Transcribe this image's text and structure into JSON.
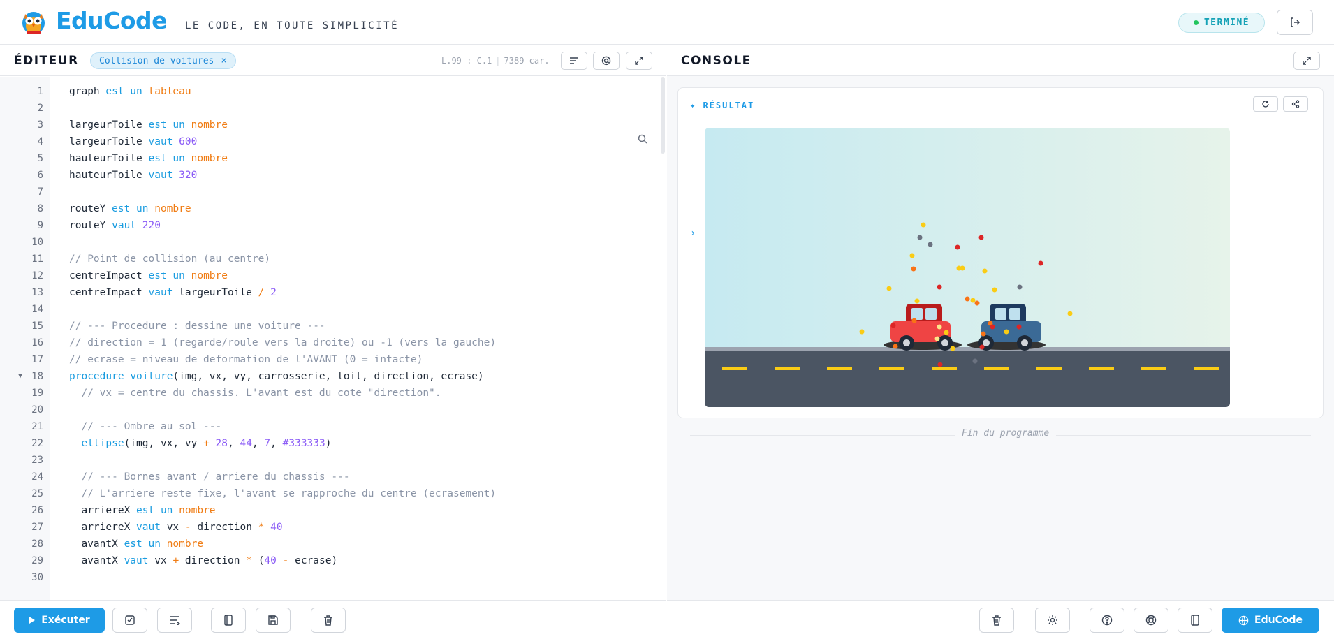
{
  "header": {
    "brand": "EduCode",
    "tagline": "LE CODE, EN TOUTE SIMPLICITÉ",
    "status": "TERMINÉ",
    "logout_icon": "logout-icon"
  },
  "editor": {
    "title": "ÉDITEUR",
    "file_tab": "Collision de voitures",
    "file_tab_close": "×",
    "cursor_line": "L.99",
    "cursor_col": "C.1",
    "char_count": "7389 car.",
    "buttons": [
      "format-icon",
      "at-icon",
      "expand-icon"
    ]
  },
  "code": {
    "line_numbers": [
      "1",
      "2",
      "3",
      "4",
      "5",
      "6",
      "7",
      "8",
      "9",
      "10",
      "11",
      "12",
      "13",
      "14",
      "15",
      "16",
      "17",
      "18",
      "19",
      "20",
      "21",
      "22",
      "23",
      "24",
      "25",
      "26",
      "27",
      "28",
      "29",
      "30"
    ],
    "lines": [
      [
        {
          "t": "graph ",
          "c": ""
        },
        {
          "t": "est un ",
          "c": "k"
        },
        {
          "t": "tableau",
          "c": "t"
        }
      ],
      [],
      [
        {
          "t": "largeurToile ",
          "c": ""
        },
        {
          "t": "est un ",
          "c": "k"
        },
        {
          "t": "nombre",
          "c": "t"
        }
      ],
      [
        {
          "t": "largeurToile ",
          "c": ""
        },
        {
          "t": "vaut ",
          "c": "k"
        },
        {
          "t": "600",
          "c": "n"
        }
      ],
      [
        {
          "t": "hauteurToile ",
          "c": ""
        },
        {
          "t": "est un ",
          "c": "k"
        },
        {
          "t": "nombre",
          "c": "t"
        }
      ],
      [
        {
          "t": "hauteurToile ",
          "c": ""
        },
        {
          "t": "vaut ",
          "c": "k"
        },
        {
          "t": "320",
          "c": "n"
        }
      ],
      [],
      [
        {
          "t": "routeY ",
          "c": ""
        },
        {
          "t": "est un ",
          "c": "k"
        },
        {
          "t": "nombre",
          "c": "t"
        }
      ],
      [
        {
          "t": "routeY ",
          "c": ""
        },
        {
          "t": "vaut ",
          "c": "k"
        },
        {
          "t": "220",
          "c": "n"
        }
      ],
      [],
      [
        {
          "t": "// Point de collision (au centre)",
          "c": "c"
        }
      ],
      [
        {
          "t": "centreImpact ",
          "c": ""
        },
        {
          "t": "est un ",
          "c": "k"
        },
        {
          "t": "nombre",
          "c": "t"
        }
      ],
      [
        {
          "t": "centreImpact ",
          "c": ""
        },
        {
          "t": "vaut ",
          "c": "k"
        },
        {
          "t": "largeurToile ",
          "c": ""
        },
        {
          "t": "/ ",
          "c": "op"
        },
        {
          "t": "2",
          "c": "n"
        }
      ],
      [],
      [
        {
          "t": "// --- Procedure : dessine une voiture ---",
          "c": "c"
        }
      ],
      [
        {
          "t": "// direction = 1 (regarde/roule vers la droite) ou -1 (vers la gauche)",
          "c": "c"
        }
      ],
      [
        {
          "t": "// ecrase = niveau de deformation de l'AVANT (0 = intacte)",
          "c": "c"
        }
      ],
      [
        {
          "t": "procedure ",
          "c": "k"
        },
        {
          "t": "voiture",
          "c": "f"
        },
        {
          "t": "(img, vx, vy, carrosserie, toit, direction, ecrase)",
          "c": ""
        }
      ],
      [
        {
          "t": "  // vx = centre du chassis. L'avant est du cote \"direction\".",
          "c": "c"
        }
      ],
      [],
      [
        {
          "t": "  // --- Ombre au sol ---",
          "c": "c"
        }
      ],
      [
        {
          "t": "  ",
          "c": ""
        },
        {
          "t": "ellipse",
          "c": "f"
        },
        {
          "t": "(img, vx, vy ",
          "c": ""
        },
        {
          "t": "+ ",
          "c": "op"
        },
        {
          "t": "28",
          "c": "n"
        },
        {
          "t": ", ",
          "c": ""
        },
        {
          "t": "44",
          "c": "n"
        },
        {
          "t": ", ",
          "c": ""
        },
        {
          "t": "7",
          "c": "n"
        },
        {
          "t": ", ",
          "c": ""
        },
        {
          "t": "#333333",
          "c": "n"
        },
        {
          "t": ")",
          "c": ""
        }
      ],
      [],
      [
        {
          "t": "  // --- Bornes avant / arriere du chassis ---",
          "c": "c"
        }
      ],
      [
        {
          "t": "  // L'arriere reste fixe, l'avant se rapproche du centre (ecrasement)",
          "c": "c"
        }
      ],
      [
        {
          "t": "  arriereX ",
          "c": ""
        },
        {
          "t": "est un ",
          "c": "k"
        },
        {
          "t": "nombre",
          "c": "t"
        }
      ],
      [
        {
          "t": "  arriereX ",
          "c": ""
        },
        {
          "t": "vaut ",
          "c": "k"
        },
        {
          "t": "vx ",
          "c": ""
        },
        {
          "t": "- ",
          "c": "op"
        },
        {
          "t": "direction ",
          "c": ""
        },
        {
          "t": "* ",
          "c": "op"
        },
        {
          "t": "40",
          "c": "n"
        }
      ],
      [
        {
          "t": "  avantX ",
          "c": ""
        },
        {
          "t": "est un ",
          "c": "k"
        },
        {
          "t": "nombre",
          "c": "t"
        }
      ],
      [
        {
          "t": "  avantX ",
          "c": ""
        },
        {
          "t": "vaut ",
          "c": "k"
        },
        {
          "t": "vx ",
          "c": ""
        },
        {
          "t": "+ ",
          "c": "op"
        },
        {
          "t": "direction ",
          "c": ""
        },
        {
          "t": "* ",
          "c": "op"
        },
        {
          "t": "(",
          "c": ""
        },
        {
          "t": "40 ",
          "c": "n"
        },
        {
          "t": "- ",
          "c": "op"
        },
        {
          "t": "ecrase)",
          "c": ""
        }
      ],
      []
    ]
  },
  "toolbar": {
    "run_label": "Exécuter",
    "buttons": [
      "check-icon",
      "indent-icon",
      "book-icon",
      "save-icon",
      "trash-icon"
    ]
  },
  "console": {
    "title": "CONSOLE",
    "result_label": "✦ RÉSULTAT",
    "prompt": "›",
    "end_text": "Fin du programme",
    "buttons": [
      "refresh-icon",
      "share-icon"
    ]
  },
  "console_toolbar": {
    "buttons": [
      "trash-icon",
      "gear-icon",
      "help-icon",
      "lifebuoy-icon",
      "book-icon"
    ],
    "brand_button": "EduCode"
  },
  "colors": {
    "accent": "#1e9be6",
    "keyword": "#1a9ce0",
    "type": "#f07d15",
    "number": "#8b5cf6",
    "comment": "#8a94a6",
    "status": "#16a2b6"
  }
}
